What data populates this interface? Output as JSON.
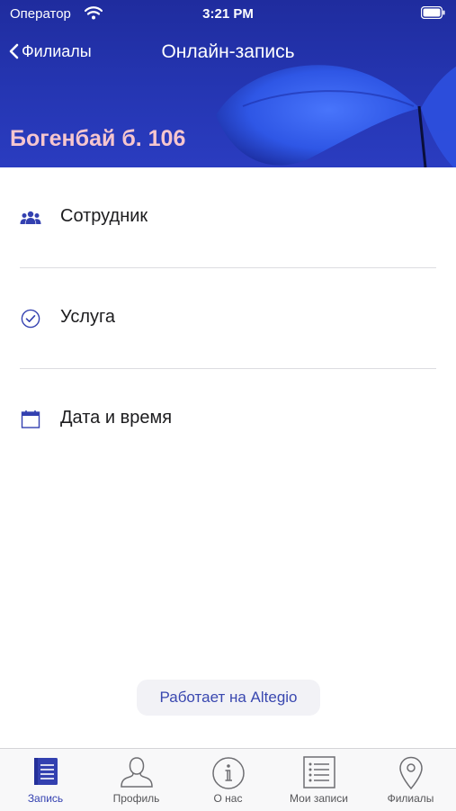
{
  "status_bar": {
    "carrier": "Оператор",
    "time": "3:21 PM"
  },
  "nav": {
    "back_label": "Филиалы",
    "title": "Онлайн-запись"
  },
  "branch": {
    "name": "Богенбай б. 106"
  },
  "menu": {
    "items": [
      {
        "label": "Сотрудник",
        "icon": "users-icon"
      },
      {
        "label": "Услуга",
        "icon": "check-circle-icon"
      },
      {
        "label": "Дата и время",
        "icon": "calendar-icon"
      }
    ]
  },
  "footer": {
    "powered_by": "Работает на Altegio"
  },
  "tabs": [
    {
      "label": "Запись",
      "icon": "booking-icon",
      "active": true
    },
    {
      "label": "Профиль",
      "icon": "profile-icon"
    },
    {
      "label": "О нас",
      "icon": "info-icon"
    },
    {
      "label": "Мои записи",
      "icon": "list-icon"
    },
    {
      "label": "Филиалы",
      "icon": "location-pin-icon"
    }
  ],
  "colors": {
    "header": "#2536b3",
    "accent": "#3340b0",
    "branch_text": "#f6c6ce"
  }
}
